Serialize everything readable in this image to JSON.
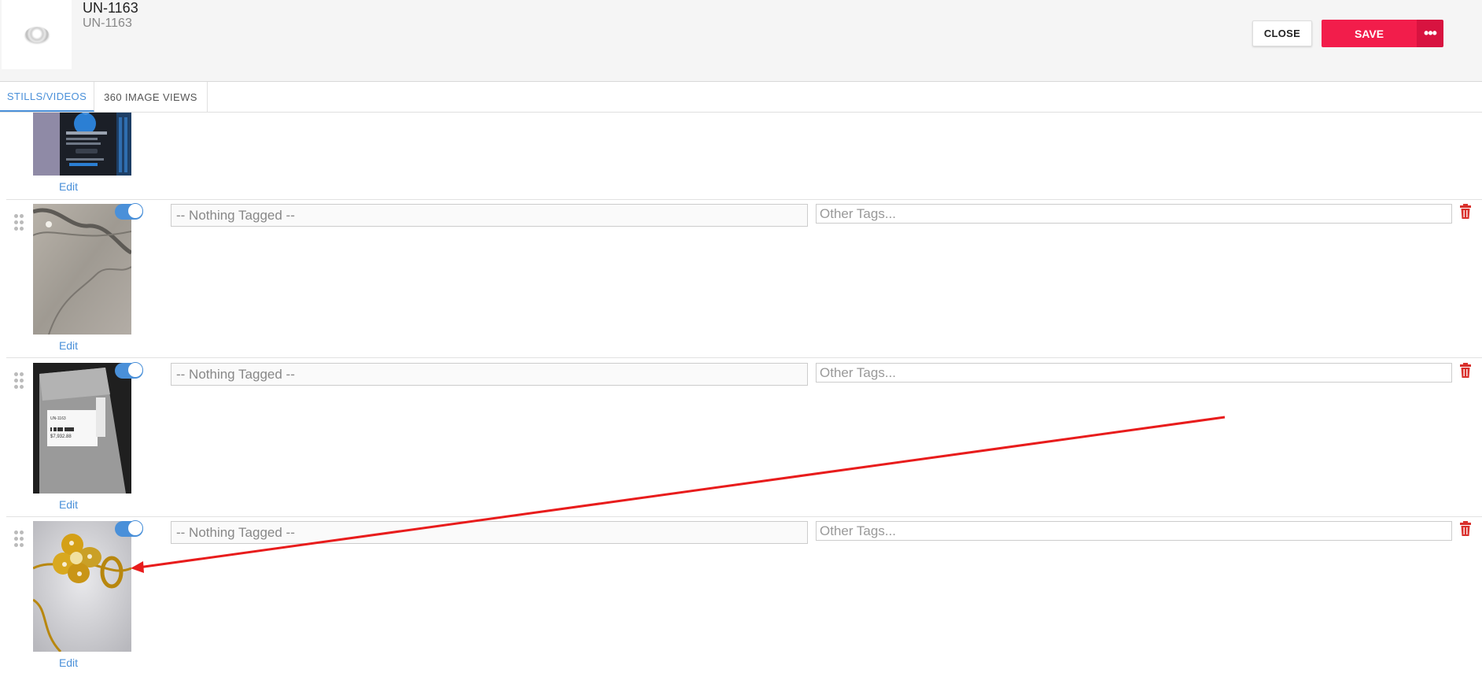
{
  "header": {
    "title": "UN-1163",
    "subtitle": "UN-1163",
    "close_label": "CLOSE",
    "save_label": "SAVE",
    "more_label": "•••",
    "thumbnail_icon": "ring-icon"
  },
  "tabs": [
    {
      "label": "STILLS/VIDEOS",
      "active": true
    },
    {
      "label": "360 IMAGE VIEWS",
      "active": false
    }
  ],
  "media": {
    "top_partial": {
      "edit_label": "Edit"
    },
    "rows": [
      {
        "tagged": "-- Nothing Tagged --",
        "other_tags_placeholder": "Other Tags...",
        "edit_label": "Edit",
        "enabled": true
      },
      {
        "tagged": "-- Nothing Tagged --",
        "other_tags_placeholder": "Other Tags...",
        "edit_label": "Edit",
        "enabled": true
      },
      {
        "tagged": "-- Nothing Tagged --",
        "other_tags_placeholder": "Other Tags...",
        "edit_label": "Edit",
        "enabled": true
      }
    ]
  },
  "photo_labels": {
    "tag_line": "UN-1163",
    "price": "$7,932.88"
  },
  "colors": {
    "accent": "#4a90d9",
    "save": "#f21d4b",
    "save_more": "#d81340",
    "delete": "#d9302c",
    "annotation_arrow": "#e81c1c"
  },
  "icons": [
    "drag-handle-icon",
    "trash-icon",
    "toggle-switch",
    "ellipsis-icon"
  ]
}
